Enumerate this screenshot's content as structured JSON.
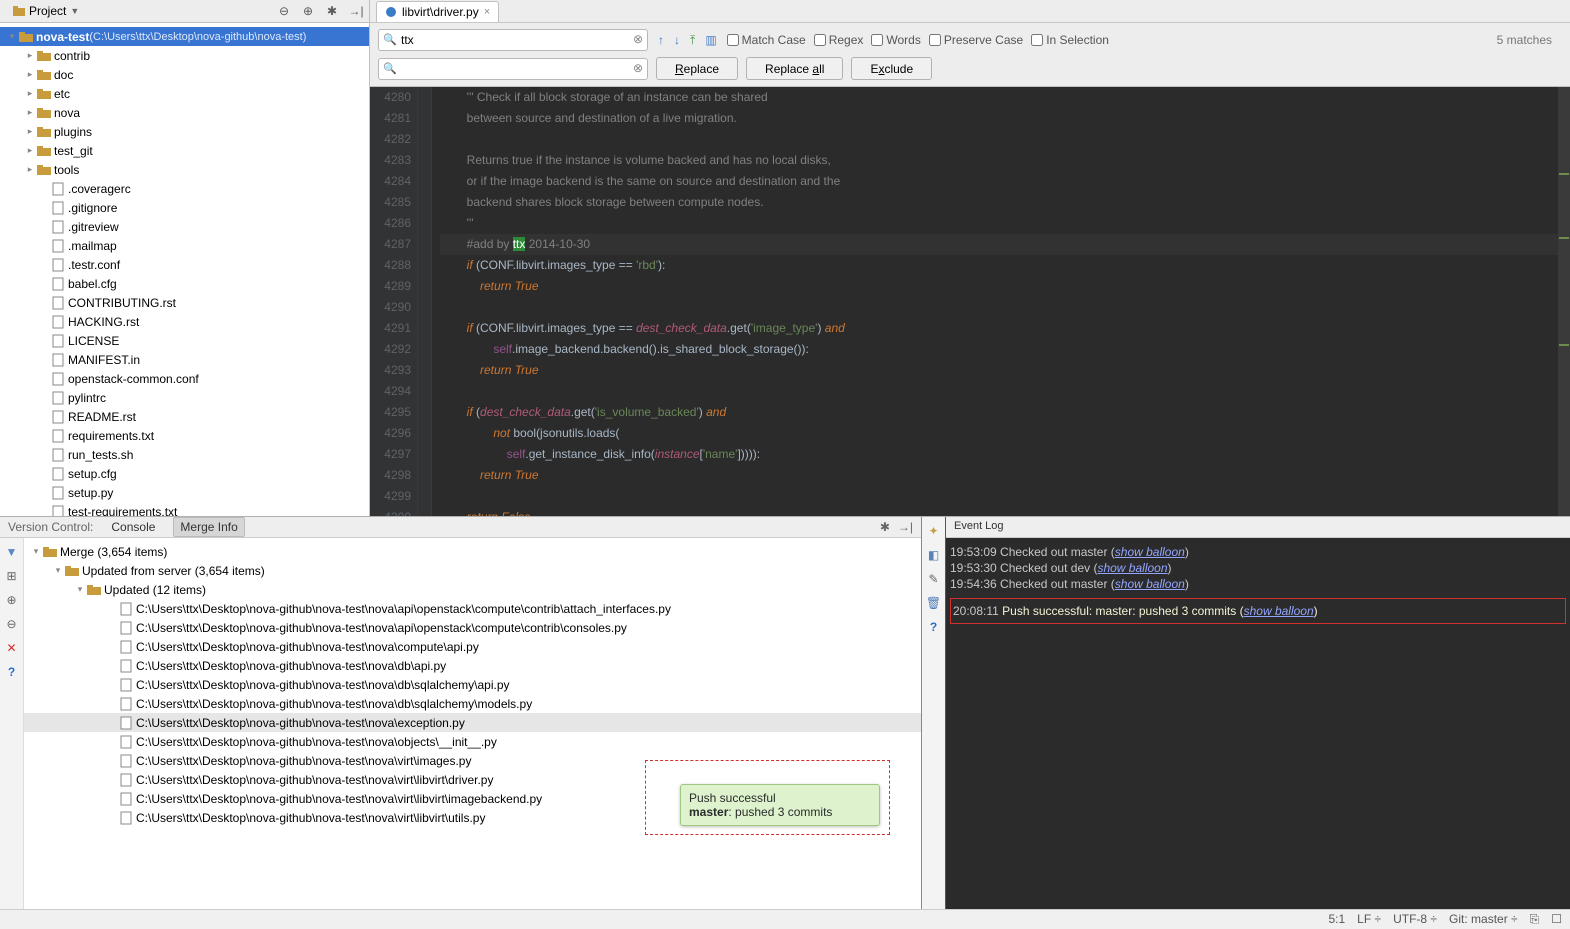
{
  "project_header": {
    "label": "Project"
  },
  "tree": {
    "root_name": "nova-test",
    "root_path": "(C:\\Users\\ttx\\Desktop\\nova-github\\nova-test)",
    "folders": [
      "contrib",
      "doc",
      "etc",
      "nova",
      "plugins",
      "test_git",
      "tools"
    ],
    "files": [
      ".coveragerc",
      ".gitignore",
      ".gitreview",
      ".mailmap",
      ".testr.conf",
      "babel.cfg",
      "CONTRIBUTING.rst",
      "HACKING.rst",
      "LICENSE",
      "MANIFEST.in",
      "openstack-common.conf",
      "pylintrc",
      "README.rst",
      "requirements.txt",
      "run_tests.sh",
      "setup.cfg",
      "setup.py",
      "test-requirements.txt"
    ]
  },
  "tab": {
    "label": "libvirt\\driver.py"
  },
  "find": {
    "search_value": "ttx",
    "replace_value": "",
    "btn_replace": "Replace",
    "btn_replace_all": "Replace all",
    "btn_exclude": "Exclude",
    "chk_match": "Match Case",
    "chk_regex": "Regex",
    "chk_words": "Words",
    "chk_preserve": "Preserve Case",
    "chk_selection": "In Selection",
    "matches": "5 matches"
  },
  "code": {
    "start": 4280,
    "highlight": "ttx",
    "lines": [
      "        ''' Check if all block storage of an instance can be shared",
      "        between source and destination of a live migration.",
      "",
      "        Returns true if the instance is volume backed and has no local disks,",
      "        or if the image backend is the same on source and destination and the",
      "        backend shares block storage between compute nodes.",
      "        '''",
      "        #add by ttx 2014-10-30",
      "        if (CONF.libvirt.images_type == 'rbd'):",
      "            return True",
      "",
      "        if (CONF.libvirt.images_type == dest_check_data.get('image_type') and",
      "                self.image_backend.backend().is_shared_block_storage()):",
      "            return True",
      "",
      "        if (dest_check_data.get('is_volume_backed') and",
      "                not bool(jsonutils.loads(",
      "                    self.get_instance_disk_info(instance['name'])))):",
      "            return True",
      "",
      "        return False"
    ]
  },
  "vc": {
    "tab_label": "Version Control:",
    "tab_console": "Console",
    "tab_merge": "Merge Info",
    "root": "Merge (3,654 items)",
    "lvl1": "Updated from server (3,654 items)",
    "lvl2": "Updated (12 items)",
    "files": [
      "C:\\Users\\ttx\\Desktop\\nova-github\\nova-test\\nova\\api\\openstack\\compute\\contrib\\attach_interfaces.py",
      "C:\\Users\\ttx\\Desktop\\nova-github\\nova-test\\nova\\api\\openstack\\compute\\contrib\\consoles.py",
      "C:\\Users\\ttx\\Desktop\\nova-github\\nova-test\\nova\\compute\\api.py",
      "C:\\Users\\ttx\\Desktop\\nova-github\\nova-test\\nova\\db\\api.py",
      "C:\\Users\\ttx\\Desktop\\nova-github\\nova-test\\nova\\db\\sqlalchemy\\api.py",
      "C:\\Users\\ttx\\Desktop\\nova-github\\nova-test\\nova\\db\\sqlalchemy\\models.py",
      "C:\\Users\\ttx\\Desktop\\nova-github\\nova-test\\nova\\exception.py",
      "C:\\Users\\ttx\\Desktop\\nova-github\\nova-test\\nova\\objects\\__init__.py",
      "C:\\Users\\ttx\\Desktop\\nova-github\\nova-test\\nova\\virt\\images.py",
      "C:\\Users\\ttx\\Desktop\\nova-github\\nova-test\\nova\\virt\\libvirt\\driver.py",
      "C:\\Users\\ttx\\Desktop\\nova-github\\nova-test\\nova\\virt\\libvirt\\imagebackend.py",
      "C:\\Users\\ttx\\Desktop\\nova-github\\nova-test\\nova\\virt\\libvirt\\utils.py"
    ],
    "selected_index": 6
  },
  "evt": {
    "title": "Event Log",
    "rows": [
      {
        "ts": "19:53:09",
        "msg": "Checked out master",
        "link": "show balloon"
      },
      {
        "ts": "19:53:30",
        "msg": "Checked out dev",
        "link": "show balloon"
      },
      {
        "ts": "19:54:36",
        "msg": "Checked out master",
        "link": "show balloon"
      }
    ],
    "push": {
      "ts": "20:08:11",
      "msg": "Push successful: master: pushed 3 commits",
      "link": "show balloon"
    }
  },
  "balloon": {
    "title": "Push successful",
    "body": "master: pushed 3 commits"
  },
  "status": {
    "left": "",
    "right": [
      "",
      "5:1",
      "LF ÷",
      "UTF-8 ÷",
      "Git: master ÷",
      "⎘",
      "☐"
    ]
  }
}
